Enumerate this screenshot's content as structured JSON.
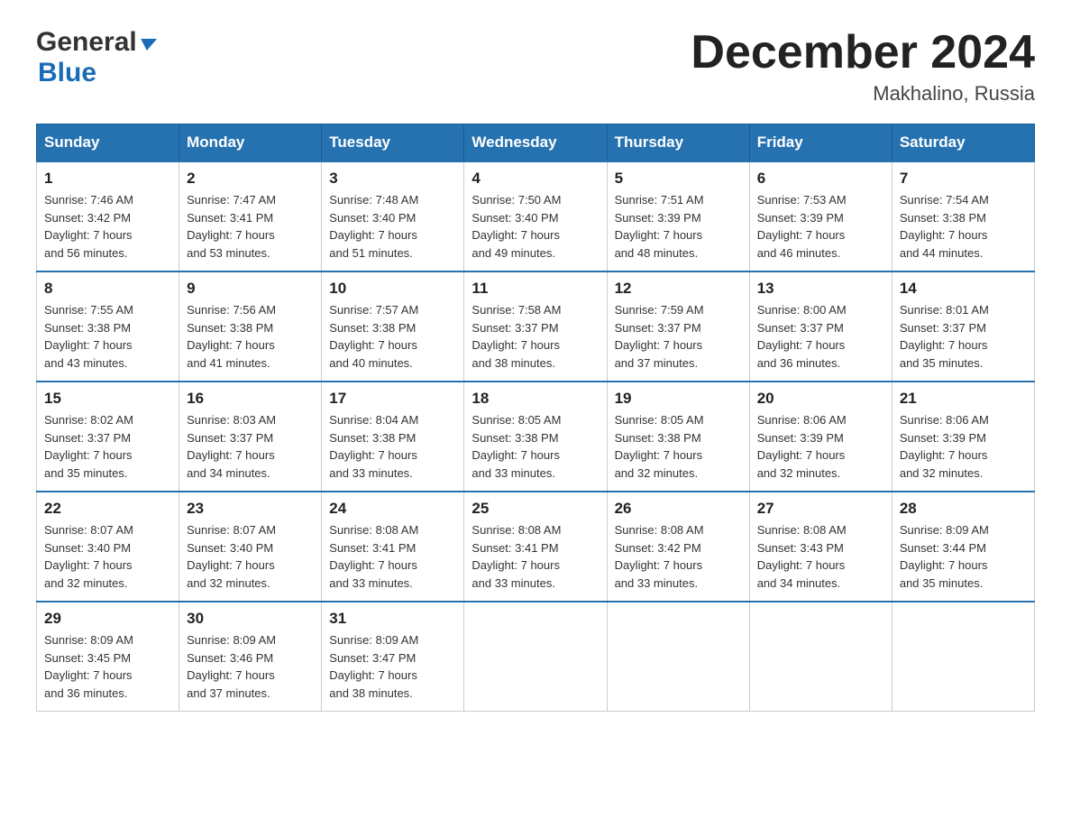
{
  "header": {
    "logo_line1": "General",
    "logo_line2": "Blue",
    "month_title": "December 2024",
    "location": "Makhalino, Russia"
  },
  "weekdays": [
    "Sunday",
    "Monday",
    "Tuesday",
    "Wednesday",
    "Thursday",
    "Friday",
    "Saturday"
  ],
  "weeks": [
    [
      {
        "day": "1",
        "info": "Sunrise: 7:46 AM\nSunset: 3:42 PM\nDaylight: 7 hours\nand 56 minutes."
      },
      {
        "day": "2",
        "info": "Sunrise: 7:47 AM\nSunset: 3:41 PM\nDaylight: 7 hours\nand 53 minutes."
      },
      {
        "day": "3",
        "info": "Sunrise: 7:48 AM\nSunset: 3:40 PM\nDaylight: 7 hours\nand 51 minutes."
      },
      {
        "day": "4",
        "info": "Sunrise: 7:50 AM\nSunset: 3:40 PM\nDaylight: 7 hours\nand 49 minutes."
      },
      {
        "day": "5",
        "info": "Sunrise: 7:51 AM\nSunset: 3:39 PM\nDaylight: 7 hours\nand 48 minutes."
      },
      {
        "day": "6",
        "info": "Sunrise: 7:53 AM\nSunset: 3:39 PM\nDaylight: 7 hours\nand 46 minutes."
      },
      {
        "day": "7",
        "info": "Sunrise: 7:54 AM\nSunset: 3:38 PM\nDaylight: 7 hours\nand 44 minutes."
      }
    ],
    [
      {
        "day": "8",
        "info": "Sunrise: 7:55 AM\nSunset: 3:38 PM\nDaylight: 7 hours\nand 43 minutes."
      },
      {
        "day": "9",
        "info": "Sunrise: 7:56 AM\nSunset: 3:38 PM\nDaylight: 7 hours\nand 41 minutes."
      },
      {
        "day": "10",
        "info": "Sunrise: 7:57 AM\nSunset: 3:38 PM\nDaylight: 7 hours\nand 40 minutes."
      },
      {
        "day": "11",
        "info": "Sunrise: 7:58 AM\nSunset: 3:37 PM\nDaylight: 7 hours\nand 38 minutes."
      },
      {
        "day": "12",
        "info": "Sunrise: 7:59 AM\nSunset: 3:37 PM\nDaylight: 7 hours\nand 37 minutes."
      },
      {
        "day": "13",
        "info": "Sunrise: 8:00 AM\nSunset: 3:37 PM\nDaylight: 7 hours\nand 36 minutes."
      },
      {
        "day": "14",
        "info": "Sunrise: 8:01 AM\nSunset: 3:37 PM\nDaylight: 7 hours\nand 35 minutes."
      }
    ],
    [
      {
        "day": "15",
        "info": "Sunrise: 8:02 AM\nSunset: 3:37 PM\nDaylight: 7 hours\nand 35 minutes."
      },
      {
        "day": "16",
        "info": "Sunrise: 8:03 AM\nSunset: 3:37 PM\nDaylight: 7 hours\nand 34 minutes."
      },
      {
        "day": "17",
        "info": "Sunrise: 8:04 AM\nSunset: 3:38 PM\nDaylight: 7 hours\nand 33 minutes."
      },
      {
        "day": "18",
        "info": "Sunrise: 8:05 AM\nSunset: 3:38 PM\nDaylight: 7 hours\nand 33 minutes."
      },
      {
        "day": "19",
        "info": "Sunrise: 8:05 AM\nSunset: 3:38 PM\nDaylight: 7 hours\nand 32 minutes."
      },
      {
        "day": "20",
        "info": "Sunrise: 8:06 AM\nSunset: 3:39 PM\nDaylight: 7 hours\nand 32 minutes."
      },
      {
        "day": "21",
        "info": "Sunrise: 8:06 AM\nSunset: 3:39 PM\nDaylight: 7 hours\nand 32 minutes."
      }
    ],
    [
      {
        "day": "22",
        "info": "Sunrise: 8:07 AM\nSunset: 3:40 PM\nDaylight: 7 hours\nand 32 minutes."
      },
      {
        "day": "23",
        "info": "Sunrise: 8:07 AM\nSunset: 3:40 PM\nDaylight: 7 hours\nand 32 minutes."
      },
      {
        "day": "24",
        "info": "Sunrise: 8:08 AM\nSunset: 3:41 PM\nDaylight: 7 hours\nand 33 minutes."
      },
      {
        "day": "25",
        "info": "Sunrise: 8:08 AM\nSunset: 3:41 PM\nDaylight: 7 hours\nand 33 minutes."
      },
      {
        "day": "26",
        "info": "Sunrise: 8:08 AM\nSunset: 3:42 PM\nDaylight: 7 hours\nand 33 minutes."
      },
      {
        "day": "27",
        "info": "Sunrise: 8:08 AM\nSunset: 3:43 PM\nDaylight: 7 hours\nand 34 minutes."
      },
      {
        "day": "28",
        "info": "Sunrise: 8:09 AM\nSunset: 3:44 PM\nDaylight: 7 hours\nand 35 minutes."
      }
    ],
    [
      {
        "day": "29",
        "info": "Sunrise: 8:09 AM\nSunset: 3:45 PM\nDaylight: 7 hours\nand 36 minutes."
      },
      {
        "day": "30",
        "info": "Sunrise: 8:09 AM\nSunset: 3:46 PM\nDaylight: 7 hours\nand 37 minutes."
      },
      {
        "day": "31",
        "info": "Sunrise: 8:09 AM\nSunset: 3:47 PM\nDaylight: 7 hours\nand 38 minutes."
      },
      null,
      null,
      null,
      null
    ]
  ]
}
